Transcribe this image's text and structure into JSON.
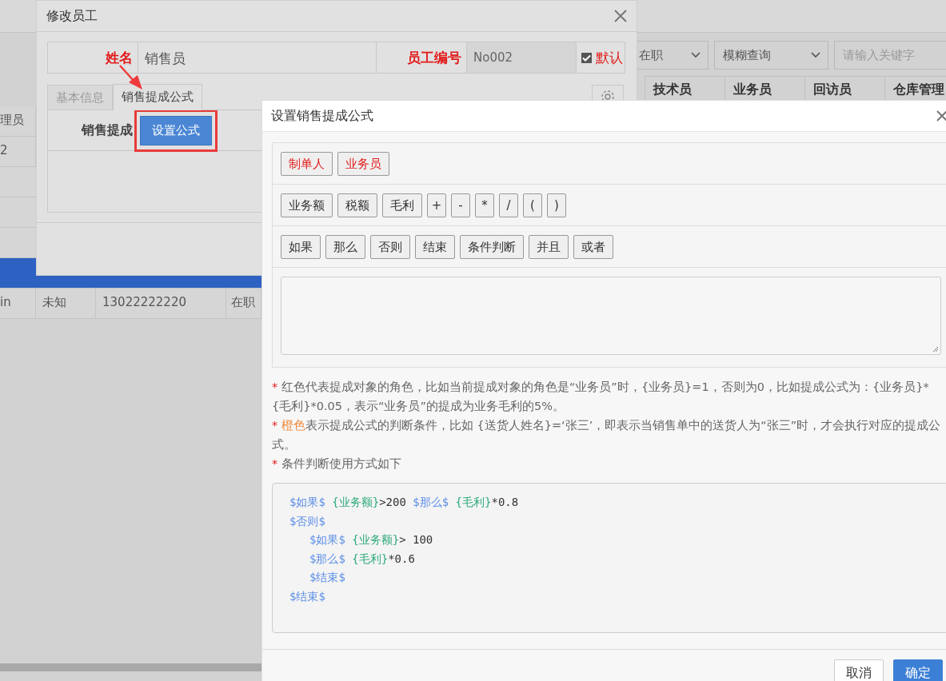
{
  "background_page": {
    "filters": [
      {
        "kind": "select",
        "value": "在职"
      },
      {
        "kind": "select",
        "value": "模糊查询"
      },
      {
        "kind": "search",
        "placeholder": "请输入关键字"
      }
    ],
    "header_columns": [
      "技术员",
      "业务员",
      "回访员",
      "仓库管理"
    ],
    "rows": [
      {
        "cells": [
          "理员"
        ],
        "selected": false
      },
      {
        "cells": [
          "2"
        ],
        "selected": false
      },
      {
        "cells": [],
        "selected": false
      },
      {
        "cells": [],
        "selected": false
      },
      {
        "cells": [],
        "selected": false
      },
      {
        "cells": [],
        "selected": true
      },
      {
        "cells": [
          "in",
          "未知",
          "13022222220",
          "在职"
        ],
        "selected": false
      }
    ]
  },
  "edit_dialog": {
    "title": "修改员工",
    "name_label": "姓名",
    "name_value": "销售员",
    "number_label": "员工编号",
    "number_value": "No002",
    "default_checkbox": {
      "label": "默认",
      "checked": true
    },
    "tabs": [
      {
        "label": "基本信息",
        "selected": false
      },
      {
        "label": "销售提成公式",
        "selected": true
      }
    ],
    "commission_label": "销售提成",
    "set_formula_button": "设置公式"
  },
  "formula_dialog": {
    "title": "设置销售提成公式",
    "button_rows": [
      {
        "buttons": [
          {
            "kind": "role",
            "label": "制单人"
          },
          {
            "kind": "role",
            "label": "业务员"
          }
        ]
      },
      {
        "buttons": [
          {
            "kind": "operand",
            "label": "业务额"
          },
          {
            "kind": "operand",
            "label": "税额"
          },
          {
            "kind": "operand",
            "label": "毛利"
          },
          {
            "kind": "operator",
            "label": "+"
          },
          {
            "kind": "operator",
            "label": "-"
          },
          {
            "kind": "operator",
            "label": "*"
          },
          {
            "kind": "operator",
            "label": "/"
          },
          {
            "kind": "operator",
            "label": "("
          },
          {
            "kind": "operator",
            "label": ")"
          }
        ]
      },
      {
        "buttons": [
          {
            "kind": "logic",
            "label": "如果"
          },
          {
            "kind": "logic",
            "label": "那么"
          },
          {
            "kind": "logic",
            "label": "否则"
          },
          {
            "kind": "logic",
            "label": "结束"
          },
          {
            "kind": "logic",
            "label": "条件判断"
          },
          {
            "kind": "logic",
            "label": "并且"
          },
          {
            "kind": "logic",
            "label": "或者"
          }
        ]
      }
    ],
    "notes": [
      {
        "segments": [
          {
            "kind": "mark",
            "text": "* "
          },
          {
            "kind": "plain",
            "text": "红色代表提成对象的角色，比如当前提成对象的角色是“业务员”时，{业务员}=1，否则为0，比如提成公式为：{业务员}*{毛利}*0.05，表示“业务员”的提成为业务毛利的5%。"
          }
        ]
      },
      {
        "segments": [
          {
            "kind": "mark",
            "text": "* "
          },
          {
            "kind": "orange",
            "text": "橙色"
          },
          {
            "kind": "plain",
            "text": "表示提成公式的判断条件，比如 {送货人姓名}=‘张三’，即表示当销售单中的送货人为“张三”时，才会执行对应的提成公式。"
          }
        ]
      },
      {
        "segments": [
          {
            "kind": "mark",
            "text": "* "
          },
          {
            "kind": "plain",
            "text": "条件判断使用方式如下"
          }
        ]
      }
    ],
    "example_lines": [
      {
        "tokens": [
          {
            "kind": "keyword",
            "text": "$如果$ "
          },
          {
            "kind": "field",
            "text": "{业务额}"
          },
          {
            "kind": "plain",
            "text": ">200 "
          },
          {
            "kind": "keyword",
            "text": "$那么$ "
          },
          {
            "kind": "field",
            "text": "{毛利}"
          },
          {
            "kind": "plain",
            "text": "*0.8"
          }
        ]
      },
      {
        "tokens": [
          {
            "kind": "keyword",
            "text": "$否则$"
          }
        ],
        "children": [
          {
            "tokens": [
              {
                "kind": "keyword",
                "text": "$如果$ "
              },
              {
                "kind": "field",
                "text": "{业务额}"
              },
              {
                "kind": "plain",
                "text": "> 100"
              }
            ]
          },
          {
            "tokens": [
              {
                "kind": "keyword",
                "text": "$那么$ "
              },
              {
                "kind": "field",
                "text": "{毛利}"
              },
              {
                "kind": "plain",
                "text": "*0.6"
              }
            ]
          },
          {
            "tokens": [
              {
                "kind": "keyword",
                "text": "$结束$"
              }
            ]
          }
        ]
      },
      {
        "tokens": [
          {
            "kind": "keyword",
            "text": "$结束$"
          }
        ]
      }
    ],
    "footer_buttons": [
      {
        "kind": "default",
        "label": "取消"
      },
      {
        "kind": "primary",
        "label": "确定"
      }
    ]
  }
}
